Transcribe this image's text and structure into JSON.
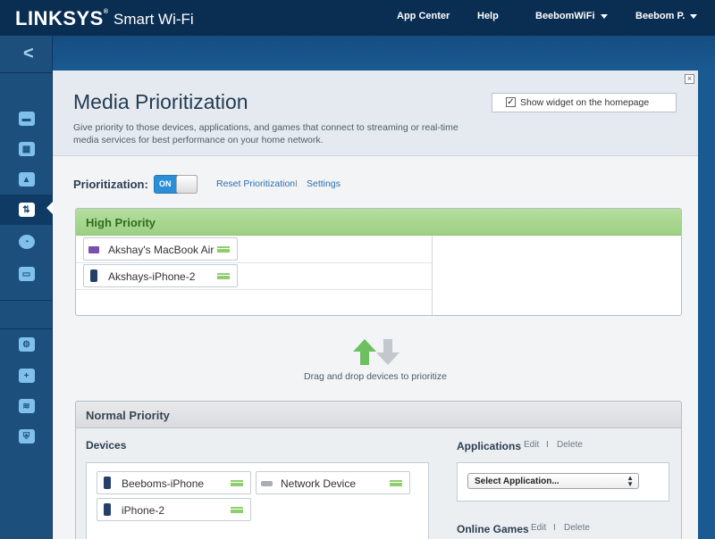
{
  "topbar": {
    "brand": "LINKSYS",
    "brand_mark": "®",
    "product": "Smart Wi-Fi",
    "app_center": "App Center",
    "help": "Help",
    "network": "BeebomWiFi",
    "user": "Beebom P."
  },
  "sidebar": {
    "back_icon": "chevron-left-icon",
    "items": [
      {
        "icon": "router-icon"
      },
      {
        "icon": "calendar-icon"
      },
      {
        "icon": "warning-icon"
      },
      {
        "icon": "media-prioritization-icon",
        "active": true
      },
      {
        "icon": "speed-test-icon"
      },
      {
        "icon": "external-storage-icon"
      },
      {
        "icon": "settings-gears-icon"
      },
      {
        "icon": "troubleshooting-icon"
      },
      {
        "icon": "wifi-settings-icon"
      },
      {
        "icon": "security-icon"
      }
    ]
  },
  "panel": {
    "close": "×",
    "title": "Media Prioritization",
    "description": "Give priority to those devices, applications, and games that connect to streaming or real-time media services for best performance on your home network.",
    "widget_checkbox_mark": "✓",
    "widget_label": "Show widget on the homepage"
  },
  "prioritization": {
    "label": "Prioritization:",
    "toggle": "ON",
    "reset": "Reset Prioritization",
    "separator": "I",
    "settings": "Settings"
  },
  "high_priority": {
    "title": "High Priority",
    "devices": [
      "Akshay's MacBook Air",
      "Akshays-iPhone-2"
    ]
  },
  "drag_hint": "Drag and drop devices to prioritize",
  "normal_priority": {
    "title": "Normal Priority",
    "devices_label": "Devices",
    "devices": [
      "Beeboms-iPhone",
      "Network Device",
      "iPhone-2"
    ],
    "applications_label": "Applications",
    "edit": "Edit",
    "separator": "I",
    "delete": "Delete",
    "select_application": "Select Application...",
    "online_games_label": "Online Games"
  },
  "colors": {
    "top_bar": "#0a2d52",
    "high_priority_header": "#a9d790",
    "toggle_on": "#2b8fd8",
    "link": "#2a6fb0"
  }
}
